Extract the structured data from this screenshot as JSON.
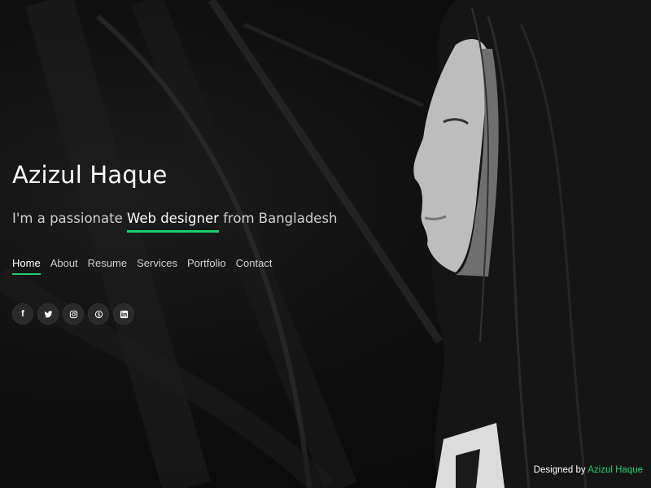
{
  "hero": {
    "name": "Azizul Haque",
    "tagline_prefix": "I'm a passionate",
    "tagline_typed": "Web designer",
    "tagline_suffix": "from Bangladesh"
  },
  "nav": {
    "items": [
      {
        "label": "Home",
        "active": true
      },
      {
        "label": "About"
      },
      {
        "label": "Resume"
      },
      {
        "label": "Services"
      },
      {
        "label": "Portfolio"
      },
      {
        "label": "Contact"
      }
    ]
  },
  "social": {
    "items": [
      {
        "icon": "facebook-icon",
        "glyph": "f"
      },
      {
        "icon": "twitter-icon",
        "glyph": "t"
      },
      {
        "icon": "instagram-icon",
        "glyph": "◎"
      },
      {
        "icon": "skype-icon",
        "glyph": "S"
      },
      {
        "icon": "linkedin-icon",
        "glyph": "in"
      }
    ]
  },
  "credits": {
    "prefix": "Designed by",
    "author": "Azizul Haque"
  },
  "colors": {
    "accent": "#18d26e",
    "background": "#0b0b0b"
  }
}
